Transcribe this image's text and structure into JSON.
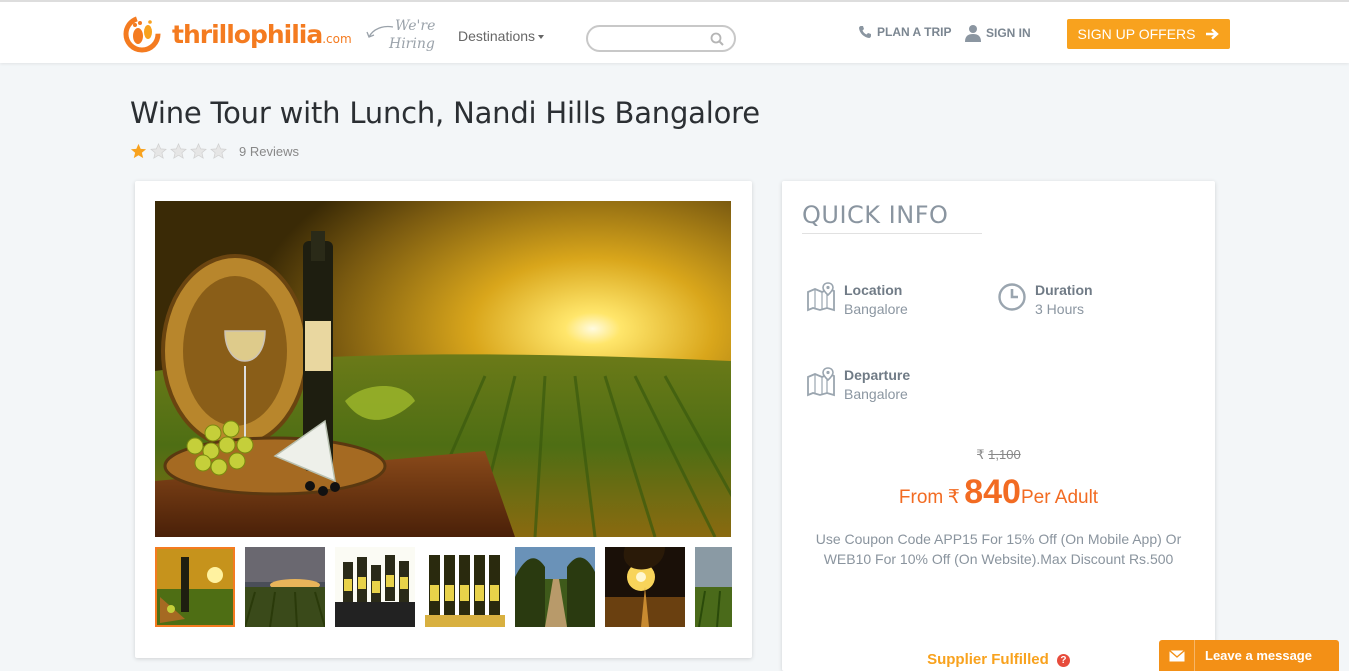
{
  "header": {
    "logo": {
      "brand": "thrillophilia",
      "suffix": ".com"
    },
    "hiring": {
      "line1": "We're",
      "line2": "Hiring"
    },
    "nav_destinations": "Destinations",
    "search_placeholder": "",
    "plan_trip": "PLAN A TRIP",
    "sign_in": "SIGN IN",
    "signup_offers": "SIGN UP OFFERS"
  },
  "product": {
    "title": "Wine Tour with Lunch, Nandi Hills Bangalore",
    "rating": {
      "filled": 1,
      "total": 5
    },
    "reviews": "9 Reviews"
  },
  "gallery": {
    "thumbnails": [
      "thumb-1",
      "thumb-2",
      "thumb-3",
      "thumb-4",
      "thumb-5",
      "thumb-6",
      "thumb-7"
    ],
    "active_index": 0
  },
  "quick_info": {
    "title": "QUICK INFO",
    "location": {
      "label": "Location",
      "value": "Bangalore"
    },
    "duration": {
      "label": "Duration",
      "value": "3 Hours"
    },
    "departure": {
      "label": "Departure",
      "value": "Bangalore"
    },
    "currency": "₹",
    "old_price": "1,100",
    "price_from": "From",
    "price": "840",
    "price_unit": "Per Adult",
    "coupon_text": "Use Coupon Code APP15 For 15% Off (On Mobile App) Or WEB10 For 10% Off (On Website).Max Discount Rs.500",
    "supplier": "Supplier Fulfilled",
    "supplier_help": "?"
  },
  "chat": {
    "label": "Leave a message"
  },
  "colors": {
    "brand": "#f47b20",
    "accent": "#f8a21e",
    "price": "#f26b22"
  }
}
